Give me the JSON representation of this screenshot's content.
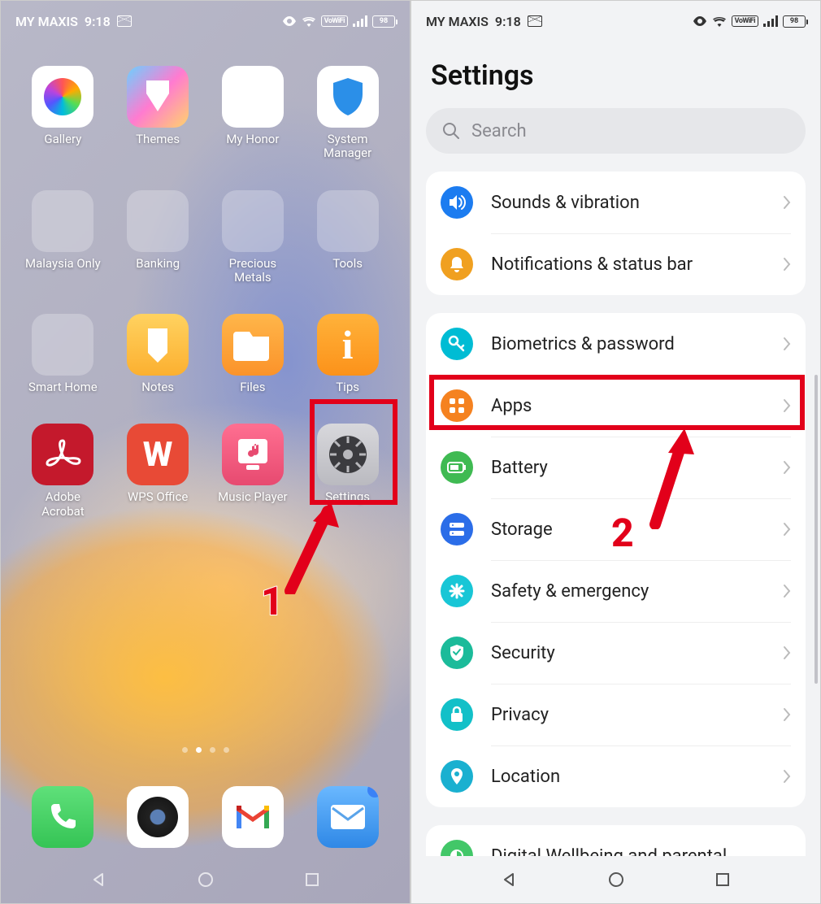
{
  "statusbar": {
    "carrier": "MY MAXIS",
    "time": "9:18",
    "battery": "98"
  },
  "home": {
    "apps_row1": [
      {
        "label": "Gallery"
      },
      {
        "label": "Themes"
      },
      {
        "label": "My Honor"
      },
      {
        "label": "System Manager"
      }
    ],
    "apps_row2": [
      {
        "label": "Malaysia Only"
      },
      {
        "label": "Banking"
      },
      {
        "label": "Precious Metals"
      },
      {
        "label": "Tools"
      }
    ],
    "apps_row3": [
      {
        "label": "Smart Home"
      },
      {
        "label": "Notes"
      },
      {
        "label": "Files"
      },
      {
        "label": "Tips"
      }
    ],
    "apps_row4": [
      {
        "label": "Adobe Acrobat"
      },
      {
        "label": "WPS Office"
      },
      {
        "label": "Music Player"
      },
      {
        "label": "Settings"
      }
    ]
  },
  "settings": {
    "title": "Settings",
    "search_placeholder": "Search",
    "group1": [
      {
        "label": "Sounds & vibration",
        "icon": "volume",
        "color": "#1c7cf0"
      },
      {
        "label": "Notifications & status bar",
        "icon": "bell",
        "color": "#f0a020"
      }
    ],
    "group2": [
      {
        "label": "Biometrics & password",
        "icon": "key",
        "color": "#00bcd4"
      },
      {
        "label": "Apps",
        "icon": "grid",
        "color": "#f58220"
      },
      {
        "label": "Battery",
        "icon": "battery",
        "color": "#3fba52"
      },
      {
        "label": "Storage",
        "icon": "storage",
        "color": "#2b6de8"
      },
      {
        "label": "Safety & emergency",
        "icon": "asterisk",
        "color": "#18c6d6"
      },
      {
        "label": "Security",
        "icon": "shield",
        "color": "#1bbb9a"
      },
      {
        "label": "Privacy",
        "icon": "lock",
        "color": "#12c0c8"
      },
      {
        "label": "Location",
        "icon": "pin",
        "color": "#1ab0d0"
      }
    ],
    "group3": [
      {
        "label": "Digital Wellbeing and parental",
        "icon": "wellbeing",
        "color": "#42c768"
      }
    ]
  },
  "annotations": {
    "step1": "1",
    "step2": "2"
  }
}
